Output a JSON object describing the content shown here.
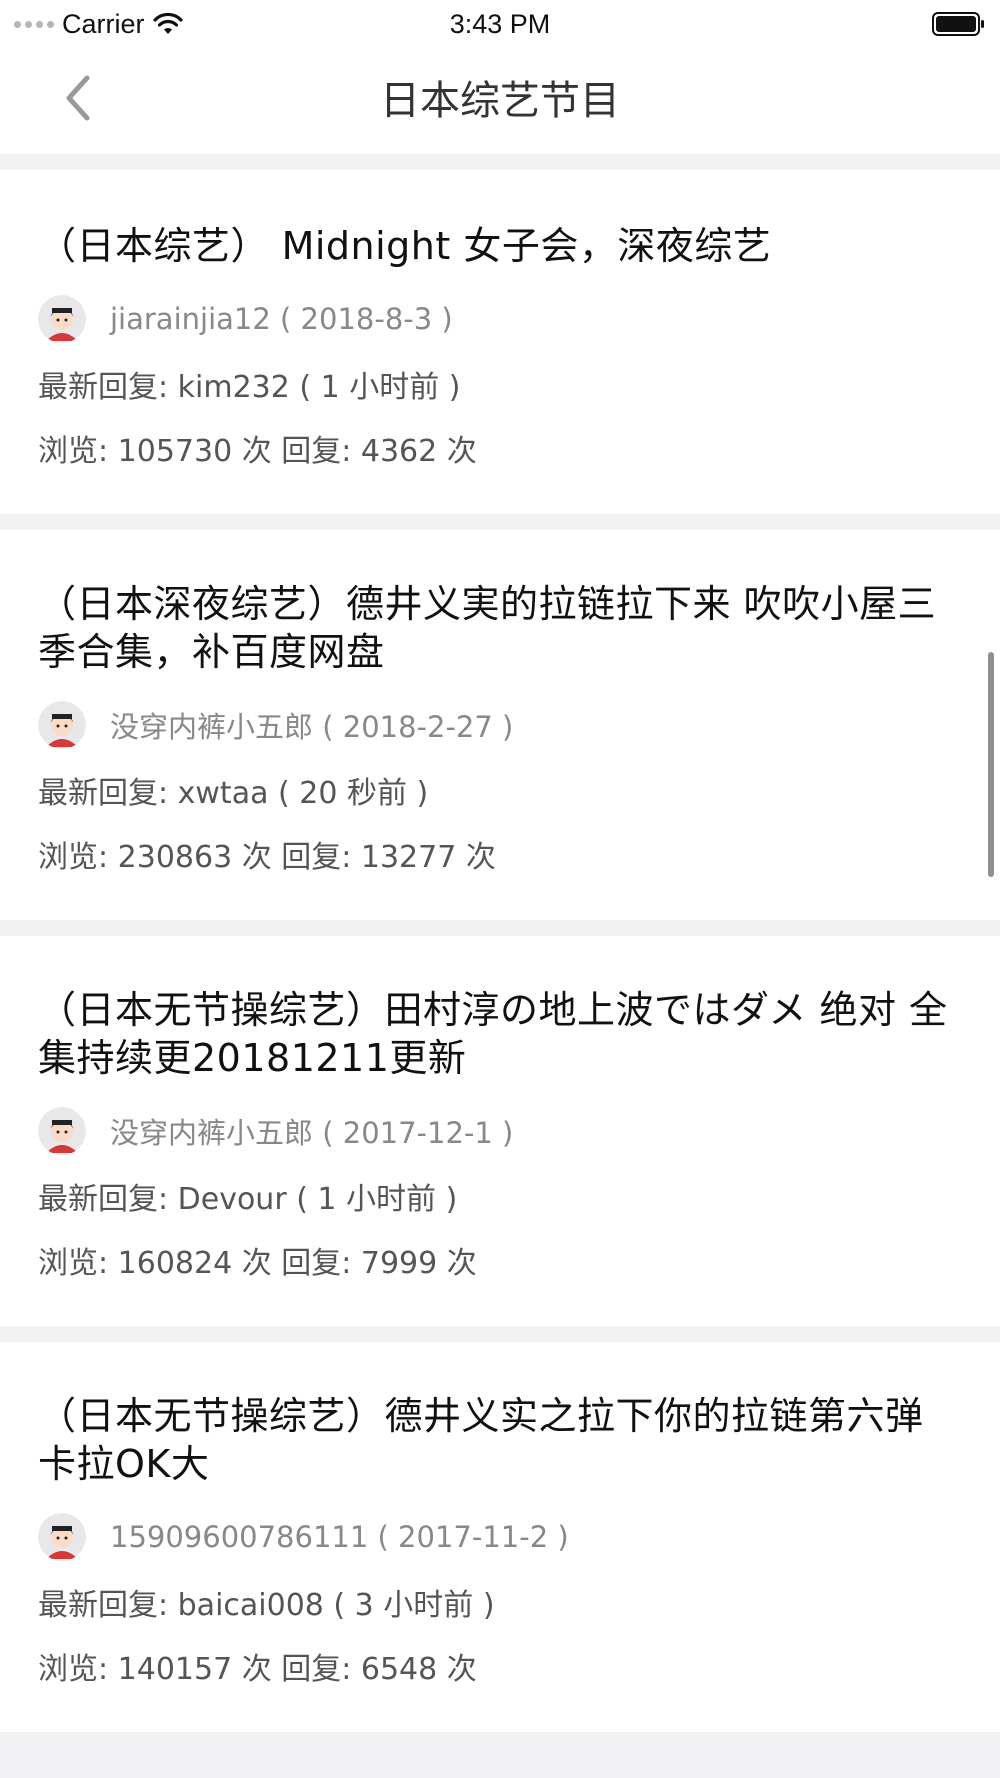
{
  "status_bar": {
    "carrier": "Carrier",
    "time": "3:43 PM",
    "icons": [
      "signal-dots-icon",
      "wifi-icon",
      "battery-icon"
    ]
  },
  "nav": {
    "title": "日本综艺节目",
    "back_icon": "chevron-left-icon"
  },
  "posts": [
    {
      "title": "（日本综艺） Midnight 女子会，深夜综艺",
      "author": "jiarainjia12 ( 2018-8-3 )",
      "latest_reply": "最新回复: kim232 ( 1 小时前 )",
      "stats": "浏览: 105730 次 回复: 4362 次"
    },
    {
      "title": "（日本深夜综艺）德井义実的拉链拉下来 吹吹小屋三季合集，补百度网盘",
      "author": "没穿内裤小五郎 ( 2018-2-27 )",
      "latest_reply": "最新回复: xwtaa ( 20 秒前 )",
      "stats": "浏览: 230863 次 回复: 13277 次"
    },
    {
      "title": "（日本无节操综艺）田村淳の地上波ではダメ 绝对 全集持续更20181211更新",
      "author": "没穿内裤小五郎 ( 2017-12-1 )",
      "latest_reply": "最新回复: Devour ( 1 小时前 )",
      "stats": "浏览: 160824 次 回复: 7999 次"
    },
    {
      "title": "（日本无节操综艺）德井义实之拉下你的拉链第六弹 卡拉OK大",
      "author": "15909600786111 ( 2017-11-2 )",
      "latest_reply": "最新回复: baicai008 ( 3 小时前 )",
      "stats": "浏览: 140157 次 回复: 6548 次"
    }
  ],
  "colors": {
    "background": "#f2f2f4",
    "card": "#ffffff",
    "title_text": "#111111",
    "meta_text": "#555555",
    "author_text": "#888888"
  }
}
